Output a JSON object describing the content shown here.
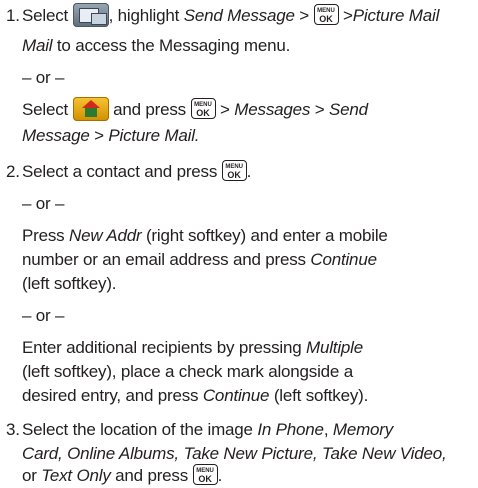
{
  "icons": {
    "messaging": "messaging-icon",
    "home": "home-icon",
    "menu_ok_top": "MENU",
    "menu_ok_bottom": "OK"
  },
  "or_text": "– or –",
  "step1": {
    "number": "1.",
    "select": "Select",
    "highlight": ", highlight",
    "send_message": "Send Message",
    "gt1": " > ",
    "gt2": " >",
    "picture_mail": "Picture Mail",
    "access": " to access the Messaging menu.",
    "select2": "Select",
    "and_press": " and press ",
    "gt3": " > ",
    "messages": "Messages",
    "gt4": " > ",
    "send": "Send",
    "message": "Message",
    "gt5": " > ",
    "picture_mail2": "Picture Mail."
  },
  "step2": {
    "number": "2.",
    "line1": "Select a contact and press",
    "line1_end": ".",
    "press": "Press",
    "new_addr": "New Addr",
    "rest1": " (right softkey) and enter a mobile",
    "rest2": "number or an email address and press",
    "continue": "Continue",
    "rest3": "(left softkey).",
    "enter": "Enter additional recipients by pressing",
    "multiple": "Multiple",
    "rest4": "(left softkey), place a check mark alongside a",
    "rest5": "desired entry, and press",
    "continue2": "Continue",
    "rest6": " (left softkey)."
  },
  "step3": {
    "number": "3.",
    "line1": "Select the location of the image",
    "in_phone": "In Phone",
    "comma": ",",
    "memory": "Memory",
    "card": "Card, Online Albums, Take New Picture, Take New Video,",
    "or": "or",
    "text_only": "Text Only",
    "and_press": " and press",
    "end": "."
  }
}
